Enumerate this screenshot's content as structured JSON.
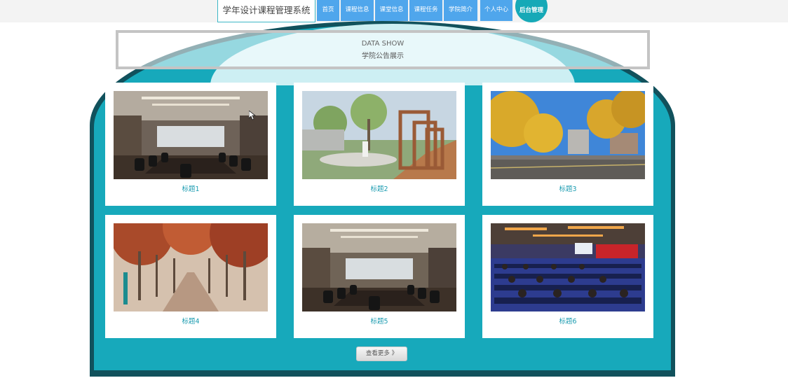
{
  "site": {
    "title": "学年设计课程管理系统"
  },
  "nav": {
    "items": [
      {
        "label": "首页"
      },
      {
        "label": "课程信息"
      },
      {
        "label": "课堂信息"
      },
      {
        "label": "课程任务"
      },
      {
        "label": "学院简介"
      },
      {
        "label": "个人中心"
      }
    ],
    "admin_label": "后台管理"
  },
  "banner": {
    "title_en": "DATA SHOW",
    "title_cn": "学院公告展示"
  },
  "cards": [
    {
      "title": "标题1",
      "image": "conference-room"
    },
    {
      "title": "标题2",
      "image": "campus-courtyard"
    },
    {
      "title": "标题3",
      "image": "autumn-ginkgo-road"
    },
    {
      "title": "标题4",
      "image": "autumn-tree-avenue"
    },
    {
      "title": "标题5",
      "image": "conference-room"
    },
    {
      "title": "标题6",
      "image": "lecture-hall"
    }
  ],
  "more_button": {
    "label": "查看更多 》"
  },
  "colors": {
    "teal": "#17a9bb",
    "teal_dark": "#11515c",
    "nav_blue": "#4fa6ec",
    "card_title": "#1a9bb0"
  }
}
